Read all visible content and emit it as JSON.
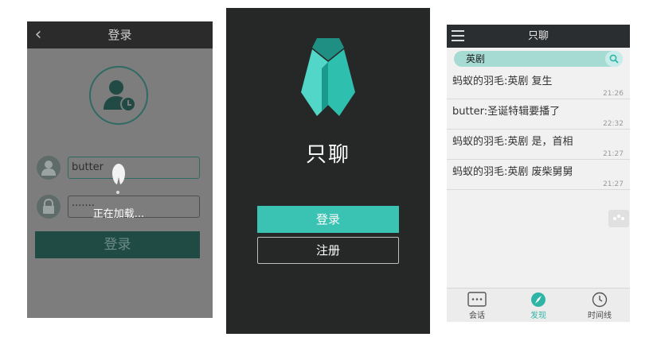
{
  "screen1": {
    "title": "登录",
    "username_value": "butter",
    "password_value": "·······",
    "login_label": "登录",
    "loading_text": "正在加载..."
  },
  "screen2": {
    "app_name": "只聊",
    "login_label": "登录",
    "register_label": "注册"
  },
  "screen3": {
    "title": "只聊",
    "search_value": "英剧",
    "messages": [
      {
        "text": "蚂蚁的羽毛:英剧 复生",
        "time": "21:26"
      },
      {
        "text": "butter:圣诞特辑要播了",
        "time": "22:32"
      },
      {
        "text": "蚂蚁的羽毛:英剧 是，首相",
        "time": "21:27"
      },
      {
        "text": "蚂蚁的羽毛:英剧 废柴舅舅",
        "time": "21:27"
      }
    ],
    "tabs": [
      {
        "label": "会话",
        "icon": "chat-bubble-icon"
      },
      {
        "label": "发现",
        "icon": "compass-icon"
      },
      {
        "label": "时间线",
        "icon": "clock-icon"
      }
    ],
    "active_tab": "发现"
  },
  "colors": {
    "accent": "#3ac2b3",
    "dark_bg": "#262828",
    "dark_teal": "#204b45"
  }
}
